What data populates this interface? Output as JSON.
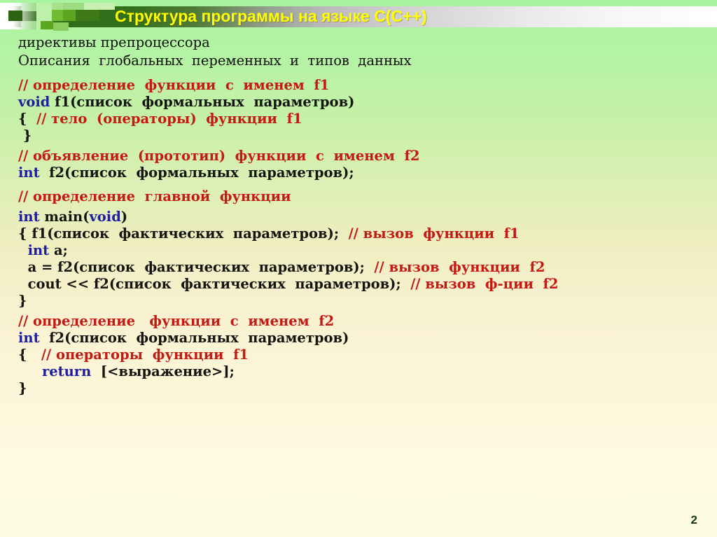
{
  "slide": {
    "title": "Структура программы на языке C(C++)",
    "page_number": "2",
    "colors": {
      "title_text": "#ffff00",
      "banner_green": "#2f6b18",
      "comment_red": "#c41a14",
      "keyword_blue": "#1f1f9e",
      "code_black": "#15150f",
      "bg_top": "#a9f4a0",
      "bg_bottom": "#fdfce4",
      "page_number": "#17350f"
    }
  },
  "prose": [
    {
      "text": "директивы препроцессора"
    },
    {
      "text": "Описания  глобальных  переменных  и  типов  данных"
    }
  ],
  "code": [
    {
      "id": "l01",
      "gap": "big",
      "tokens": [
        {
          "t": "comment",
          "s": "// определение  функции  с  именем  f1"
        }
      ]
    },
    {
      "id": "l02",
      "gap": "none",
      "tokens": [
        {
          "t": "keyword",
          "s": "void"
        },
        {
          "t": "plain",
          "s": " f1(список  формальных  параметров)"
        }
      ]
    },
    {
      "id": "l03",
      "gap": "none",
      "tokens": [
        {
          "t": "plain",
          "s": "{ "
        },
        {
          "t": "comment",
          "s": " // тело  (операторы)  функции  f1"
        }
      ]
    },
    {
      "id": "l04",
      "gap": "none",
      "tokens": [
        {
          "t": "plain",
          "s": " }"
        }
      ]
    },
    {
      "id": "l05",
      "gap": "small",
      "tokens": [
        {
          "t": "comment",
          "s": "// объявление  (прототип)  функции  с  именем  f2"
        }
      ]
    },
    {
      "id": "l06",
      "gap": "none",
      "tokens": [
        {
          "t": "keyword",
          "s": "int"
        },
        {
          "t": "plain",
          "s": "  f2(список  формальных  параметров);"
        }
      ]
    },
    {
      "id": "l07",
      "gap": "big",
      "tokens": [
        {
          "t": "comment",
          "s": "// определение  главной  функции"
        }
      ]
    },
    {
      "id": "l08",
      "gap": "small",
      "tokens": [
        {
          "t": "keyword",
          "s": "int"
        },
        {
          "t": "plain",
          "s": " main("
        },
        {
          "t": "keyword",
          "s": "void"
        },
        {
          "t": "plain",
          "s": ")"
        }
      ]
    },
    {
      "id": "l09",
      "gap": "none",
      "tokens": [
        {
          "t": "plain",
          "s": "{ f1(список  фактических  параметров);  "
        },
        {
          "t": "comment",
          "s": "// вызов  функции  f1"
        }
      ]
    },
    {
      "id": "l10",
      "gap": "none",
      "tokens": [
        {
          "t": "keyword",
          "s": "  int"
        },
        {
          "t": "plain",
          "s": " a;"
        }
      ]
    },
    {
      "id": "l11",
      "gap": "none",
      "tokens": [
        {
          "t": "plain",
          "s": "  a = f2(список  фактических  параметров);  "
        },
        {
          "t": "comment",
          "s": "// вызов  функции  f2"
        }
      ]
    },
    {
      "id": "l12",
      "gap": "none",
      "tokens": [
        {
          "t": "plain",
          "s": "  cout << f2(список  фактических  параметров);  "
        },
        {
          "t": "comment",
          "s": "// вызов  ф-ции  f2"
        }
      ]
    },
    {
      "id": "l13",
      "gap": "none",
      "tokens": [
        {
          "t": "plain",
          "s": "}"
        }
      ]
    },
    {
      "id": "l14",
      "gap": "small",
      "tokens": [
        {
          "t": "comment",
          "s": "// определение   функции  с  именем  f2"
        }
      ]
    },
    {
      "id": "l15",
      "gap": "none",
      "tokens": [
        {
          "t": "keyword",
          "s": "int"
        },
        {
          "t": "plain",
          "s": "  f2(список  формальных  параметров)"
        }
      ]
    },
    {
      "id": "l16",
      "gap": "none",
      "tokens": [
        {
          "t": "plain",
          "s": "{   "
        },
        {
          "t": "comment",
          "s": "// операторы  функции  f1"
        }
      ]
    },
    {
      "id": "l17",
      "gap": "none",
      "tokens": [
        {
          "t": "keyword",
          "s": "     return"
        },
        {
          "t": "plain",
          "s": "  [<выражение>];"
        }
      ]
    },
    {
      "id": "l18",
      "gap": "none",
      "tokens": [
        {
          "t": "plain",
          "s": "}"
        }
      ]
    }
  ]
}
